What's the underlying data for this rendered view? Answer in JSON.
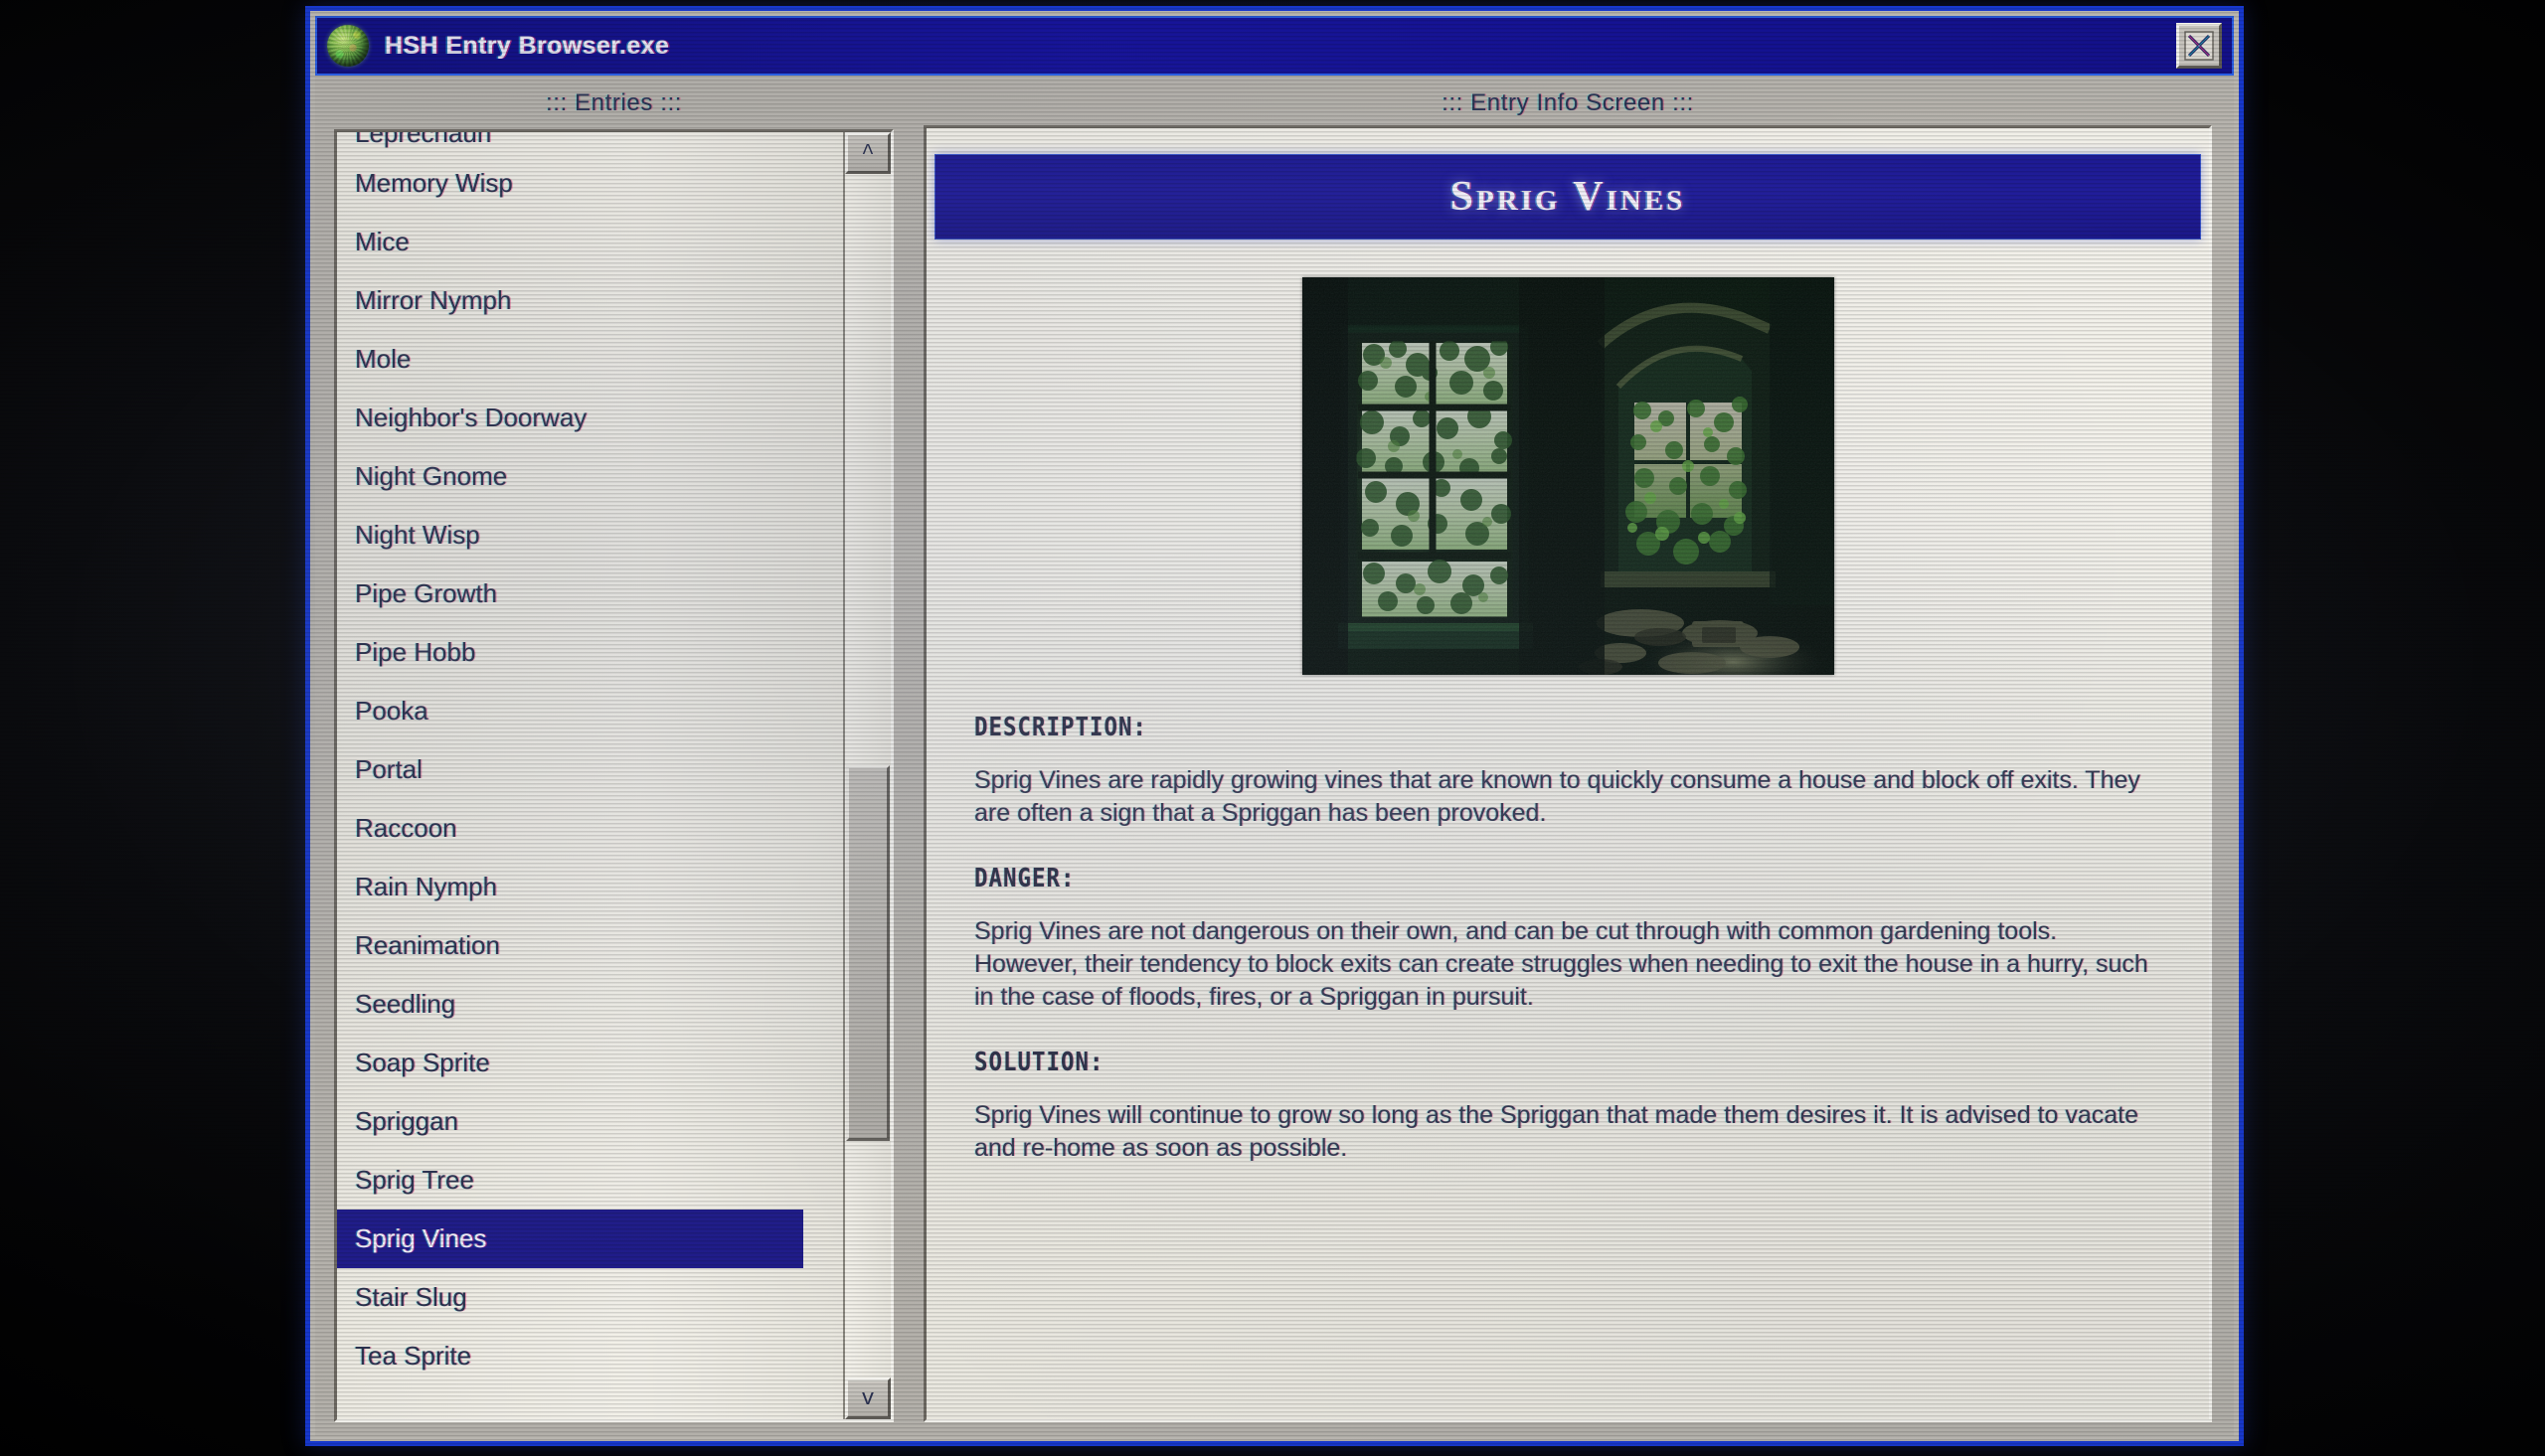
{
  "window": {
    "title": "HSH Entry Browser.exe",
    "icon": "globe-orb-icon",
    "close_label": "X",
    "accent_border": "#1838c8",
    "titlebar_color": "#131185",
    "body_color": "#b9b6b0"
  },
  "left_panel": {
    "heading": "::: Entries :::",
    "items": [
      "Leprechaun",
      "Memory Wisp",
      "Mice",
      "Mirror Nymph",
      "Mole",
      "Neighbor's Doorway",
      "Night Gnome",
      "Night Wisp",
      "Pipe Growth",
      "Pipe Hobb",
      "Pooka",
      "Portal",
      "Raccoon",
      "Rain Nymph",
      "Reanimation",
      "Seedling",
      "Soap Sprite",
      "Spriggan",
      "Sprig Tree",
      "Sprig Vines",
      "Stair Slug",
      "Tea Sprite"
    ],
    "selected_item": "Sprig Vines",
    "selected_index": 19,
    "selection_color": "#201c86",
    "scrollbar": {
      "up_label": "^",
      "down_label": "v"
    }
  },
  "right_panel": {
    "heading": "::: Entry Info Screen :::",
    "entry_title": "Sprig Vines",
    "banner_color": "#1d1a90",
    "photo": {
      "name": "abandoned-room-overgrown-windows-photo",
      "alt": "Dark interior of an abandoned brick room with two windows overgrown by green vines"
    },
    "sections": [
      {
        "heading": "DESCRIPTION:",
        "body": "Sprig Vines are rapidly growing vines that are known to quickly consume a house and block off exits. They are often a sign that a Spriggan has been provoked."
      },
      {
        "heading": "DANGER:",
        "body": "Sprig Vines are not dangerous on their own, and can be cut through with common gardening tools. However, their tendency to block exits can create struggles when needing to exit the house in a hurry, such in the case of floods, fires, or a Spriggan in pursuit."
      },
      {
        "heading": "SOLUTION:",
        "body": "Sprig Vines will continue to grow so long as the Spriggan that made them desires it. It is advised to vacate and re-home as soon as possible."
      }
    ]
  }
}
